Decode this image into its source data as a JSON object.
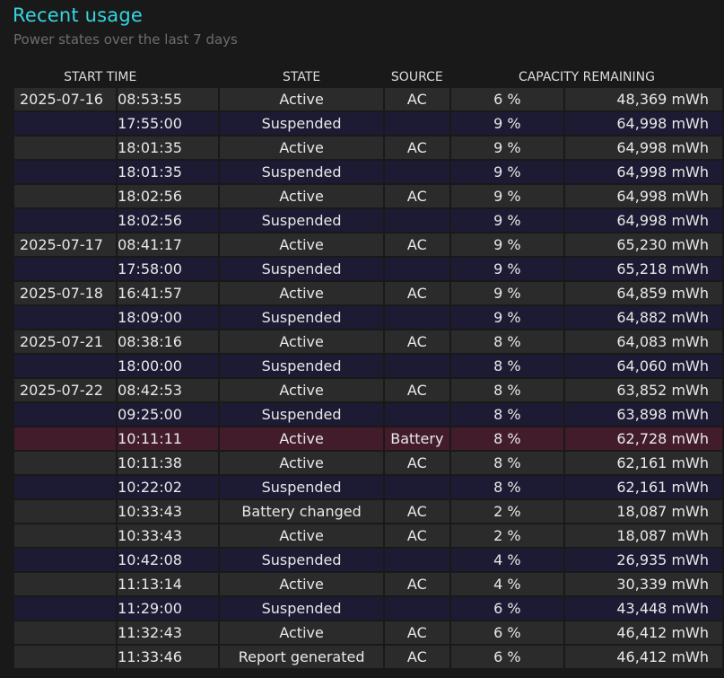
{
  "header": {
    "title": "Recent usage",
    "subtitle": "Power states over the last 7 days"
  },
  "columns": {
    "start_time": "START TIME",
    "state": "STATE",
    "source": "SOURCE",
    "capacity": "CAPACITY REMAINING"
  },
  "rows": [
    {
      "date": "2025-07-16",
      "time": "08:53:55",
      "state": "Active",
      "source": "AC",
      "pct": "6 %",
      "mwh": "48,369 mWh"
    },
    {
      "date": "",
      "time": "17:55:00",
      "state": "Suspended",
      "source": "",
      "pct": "9 %",
      "mwh": "64,998 mWh"
    },
    {
      "date": "",
      "time": "18:01:35",
      "state": "Active",
      "source": "AC",
      "pct": "9 %",
      "mwh": "64,998 mWh"
    },
    {
      "date": "",
      "time": "18:01:35",
      "state": "Suspended",
      "source": "",
      "pct": "9 %",
      "mwh": "64,998 mWh"
    },
    {
      "date": "",
      "time": "18:02:56",
      "state": "Active",
      "source": "AC",
      "pct": "9 %",
      "mwh": "64,998 mWh"
    },
    {
      "date": "",
      "time": "18:02:56",
      "state": "Suspended",
      "source": "",
      "pct": "9 %",
      "mwh": "64,998 mWh"
    },
    {
      "date": "2025-07-17",
      "time": "08:41:17",
      "state": "Active",
      "source": "AC",
      "pct": "9 %",
      "mwh": "65,230 mWh"
    },
    {
      "date": "",
      "time": "17:58:00",
      "state": "Suspended",
      "source": "",
      "pct": "9 %",
      "mwh": "65,218 mWh"
    },
    {
      "date": "2025-07-18",
      "time": "16:41:57",
      "state": "Active",
      "source": "AC",
      "pct": "9 %",
      "mwh": "64,859 mWh"
    },
    {
      "date": "",
      "time": "18:09:00",
      "state": "Suspended",
      "source": "",
      "pct": "9 %",
      "mwh": "64,882 mWh"
    },
    {
      "date": "2025-07-21",
      "time": "08:38:16",
      "state": "Active",
      "source": "AC",
      "pct": "8 %",
      "mwh": "64,083 mWh"
    },
    {
      "date": "",
      "time": "18:00:00",
      "state": "Suspended",
      "source": "",
      "pct": "8 %",
      "mwh": "64,060 mWh"
    },
    {
      "date": "2025-07-22",
      "time": "08:42:53",
      "state": "Active",
      "source": "AC",
      "pct": "8 %",
      "mwh": "63,852 mWh"
    },
    {
      "date": "",
      "time": "09:25:00",
      "state": "Suspended",
      "source": "",
      "pct": "8 %",
      "mwh": "63,898 mWh"
    },
    {
      "date": "",
      "time": "10:11:11",
      "state": "Active",
      "source": "Battery",
      "pct": "8 %",
      "mwh": "62,728 mWh"
    },
    {
      "date": "",
      "time": "10:11:38",
      "state": "Active",
      "source": "AC",
      "pct": "8 %",
      "mwh": "62,161 mWh"
    },
    {
      "date": "",
      "time": "10:22:02",
      "state": "Suspended",
      "source": "",
      "pct": "8 %",
      "mwh": "62,161 mWh"
    },
    {
      "date": "",
      "time": "10:33:43",
      "state": "Battery changed",
      "source": "AC",
      "pct": "2 %",
      "mwh": "18,087 mWh"
    },
    {
      "date": "",
      "time": "10:33:43",
      "state": "Active",
      "source": "AC",
      "pct": "2 %",
      "mwh": "18,087 mWh"
    },
    {
      "date": "",
      "time": "10:42:08",
      "state": "Suspended",
      "source": "",
      "pct": "4 %",
      "mwh": "26,935 mWh"
    },
    {
      "date": "",
      "time": "11:13:14",
      "state": "Active",
      "source": "AC",
      "pct": "4 %",
      "mwh": "30,339 mWh"
    },
    {
      "date": "",
      "time": "11:29:00",
      "state": "Suspended",
      "source": "",
      "pct": "6 %",
      "mwh": "43,448 mWh"
    },
    {
      "date": "",
      "time": "11:32:43",
      "state": "Active",
      "source": "AC",
      "pct": "6 %",
      "mwh": "46,412 mWh"
    },
    {
      "date": "",
      "time": "11:33:46",
      "state": "Report generated",
      "source": "AC",
      "pct": "6 %",
      "mwh": "46,412 mWh"
    }
  ],
  "colors": {
    "title": "#35d6e0",
    "row_active": "#2b2b2b",
    "row_suspended": "#1c1b33",
    "row_battery": "#431c2c"
  }
}
